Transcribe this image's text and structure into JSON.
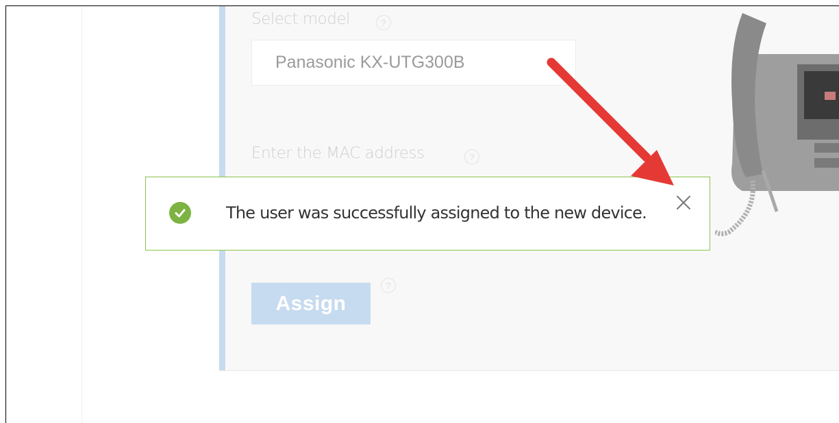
{
  "form": {
    "model_label": "Select model",
    "model_value": "Panasonic KX-UTG300B",
    "mac_label": "Enter the MAC address",
    "help_glyph": "?",
    "assign_label": "Assign"
  },
  "toast": {
    "message": "The user was successfully assigned to the new device.",
    "close_glyph": "×",
    "status": "success",
    "accent_color": "#8bc34a"
  },
  "annotation": {
    "arrow_color": "#e53935",
    "points_to": "toast-close-button"
  },
  "colors": {
    "panel_accent": "#c6dbef",
    "button_bg": "#c6dbef",
    "success_icon": "#7cb342"
  }
}
